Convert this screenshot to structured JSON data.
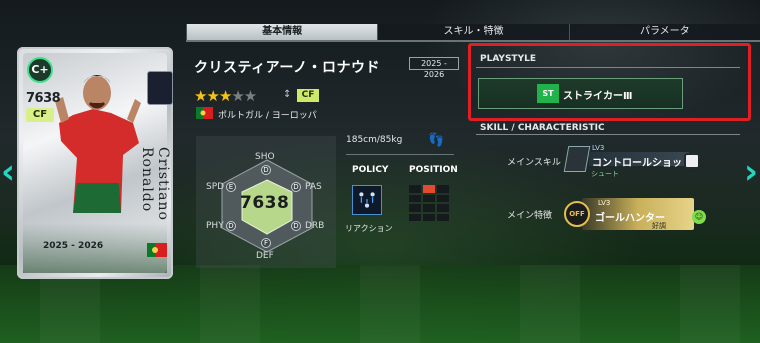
{
  "tabs": [
    "基本情報",
    "スキル・特徴",
    "パラメータ"
  ],
  "card": {
    "ovr_badge": "C+",
    "ovr": "7638",
    "position": "CF",
    "name_vertical": "Cristiano Ronaldo",
    "season": "2025 - 2026"
  },
  "player": {
    "name": "クリスティアーノ・ロナウド",
    "season_tag": "2025 - 2026",
    "stars_on": "★★★",
    "stars_off": "★★",
    "position": "CF",
    "nation": "ポルトガル / ヨーロッパ",
    "height_weight": "185cm/85kg"
  },
  "stats": {
    "labels": {
      "sho": "SHO",
      "pas": "PAS",
      "drb": "DRB",
      "def": "DEF",
      "phy": "PHY",
      "spd": "SPD"
    },
    "grades": {
      "sho": "D",
      "pas": "D",
      "drb": "D",
      "def": "F",
      "phy": "D",
      "spd": "E"
    },
    "ovr": "7638"
  },
  "policy": {
    "header": "POLICY",
    "label": "リアクション"
  },
  "position_panel": {
    "header": "POSITION"
  },
  "playstyle": {
    "title": "PLAYSTYLE",
    "badge": "ST",
    "name": "ストライカーⅢ"
  },
  "skills": {
    "title": "SKILL / CHARACTERISTIC",
    "main_skill_label": "メインスキル",
    "main_skill_lv": "LV3",
    "main_skill_name": "コントロールショット",
    "main_skill_sub": "シュート",
    "main_trait_label": "メイン特徴",
    "main_trait_lv": "LV3",
    "main_trait_icon": "OFF",
    "main_trait_name": "ゴールハンター",
    "main_trait_sub": "好調"
  },
  "colors": {
    "accent": "#25d6c0",
    "highlight_box": "#e01f24",
    "star": "#f2c417"
  }
}
